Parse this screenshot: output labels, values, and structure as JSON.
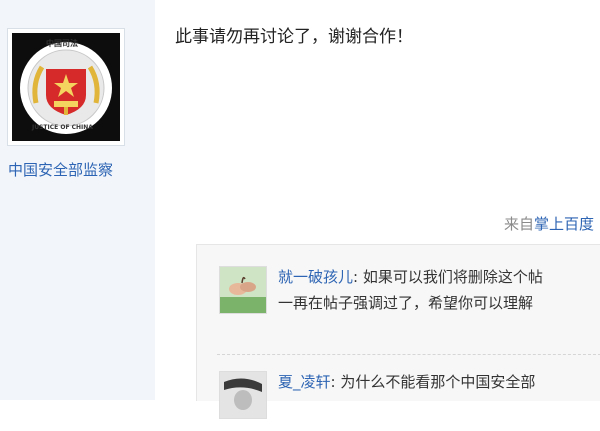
{
  "author": {
    "avatar_icon": "justice-of-china-emblem-icon",
    "avatar_text_top": "中国司法",
    "avatar_text_bottom": "JUSTICE OF CHINA",
    "name": "中国安全部监察"
  },
  "post": {
    "body": "此事请勿再讨论了，谢谢合作！",
    "from_prefix": "来自",
    "from_source": "掌上百度"
  },
  "comments": [
    {
      "avatar_icon": "hands-photo-icon",
      "user": "就一破孩儿",
      "separator": ":",
      "text": "如果可以我们将删除这个帖",
      "text_line2": "一再在帖子强调过了，希望你可以理解"
    },
    {
      "avatar_icon": "portrait-photo-icon",
      "user": "夏_凌轩",
      "separator": ":",
      "text": "为什么不能看那个中国安全部"
    }
  ],
  "colors": {
    "sidebar_bg": "#f2f6fb",
    "link": "#2d64b3",
    "comment_bg": "#f7f7f7",
    "emblem_red": "#d62a2a",
    "emblem_gold": "#e0b53a"
  }
}
